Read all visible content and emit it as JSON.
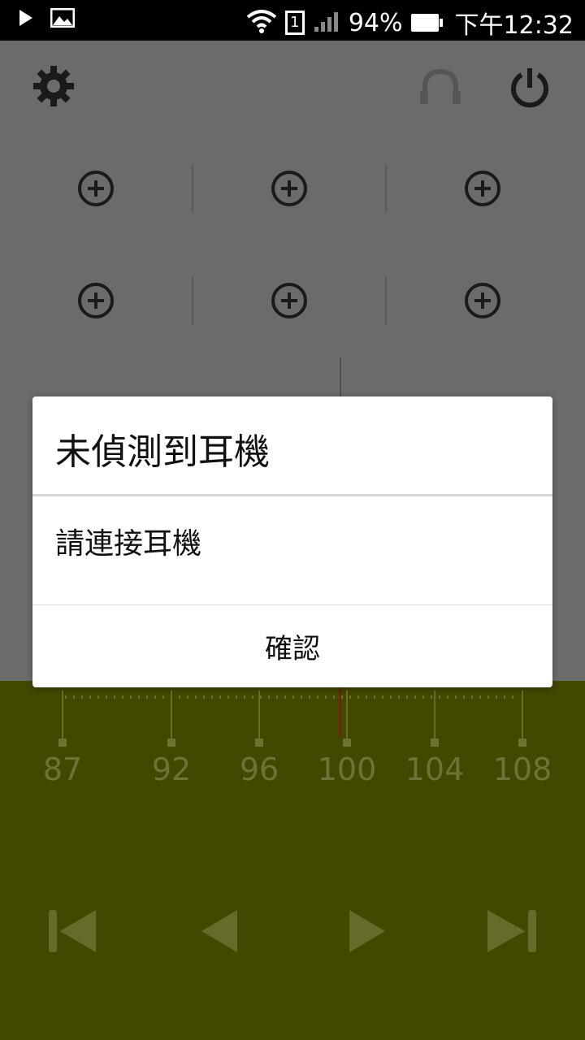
{
  "status_bar": {
    "battery_percent": "94%",
    "time": "下午12:32",
    "sim_label": "1",
    "icons": [
      "play-icon",
      "image-icon",
      "wifi-icon",
      "sim-icon",
      "signal-icon",
      "battery-icon"
    ]
  },
  "toolbar": {
    "settings_icon": "gear-icon",
    "headset_icon": "headset-icon",
    "power_icon": "power-icon"
  },
  "presets": {
    "add_icon": "plus-circle-icon",
    "count": 6
  },
  "dial": {
    "labels": [
      "87",
      "92",
      "96",
      "100",
      "104",
      "108"
    ],
    "current_frequency_mhz": 100
  },
  "controls": {
    "icons": [
      "skip-previous-icon",
      "seek-previous-icon",
      "seek-next-icon",
      "skip-next-icon"
    ]
  },
  "dialog": {
    "title": "未偵測到耳機",
    "message": "請連接耳機",
    "confirm_label": "確認"
  },
  "colors": {
    "status_bar": "#000000",
    "app_background_dimmed": "#6b6b6b",
    "dial_background_dimmed": "#434800",
    "dialog_background": "#ffffff"
  }
}
